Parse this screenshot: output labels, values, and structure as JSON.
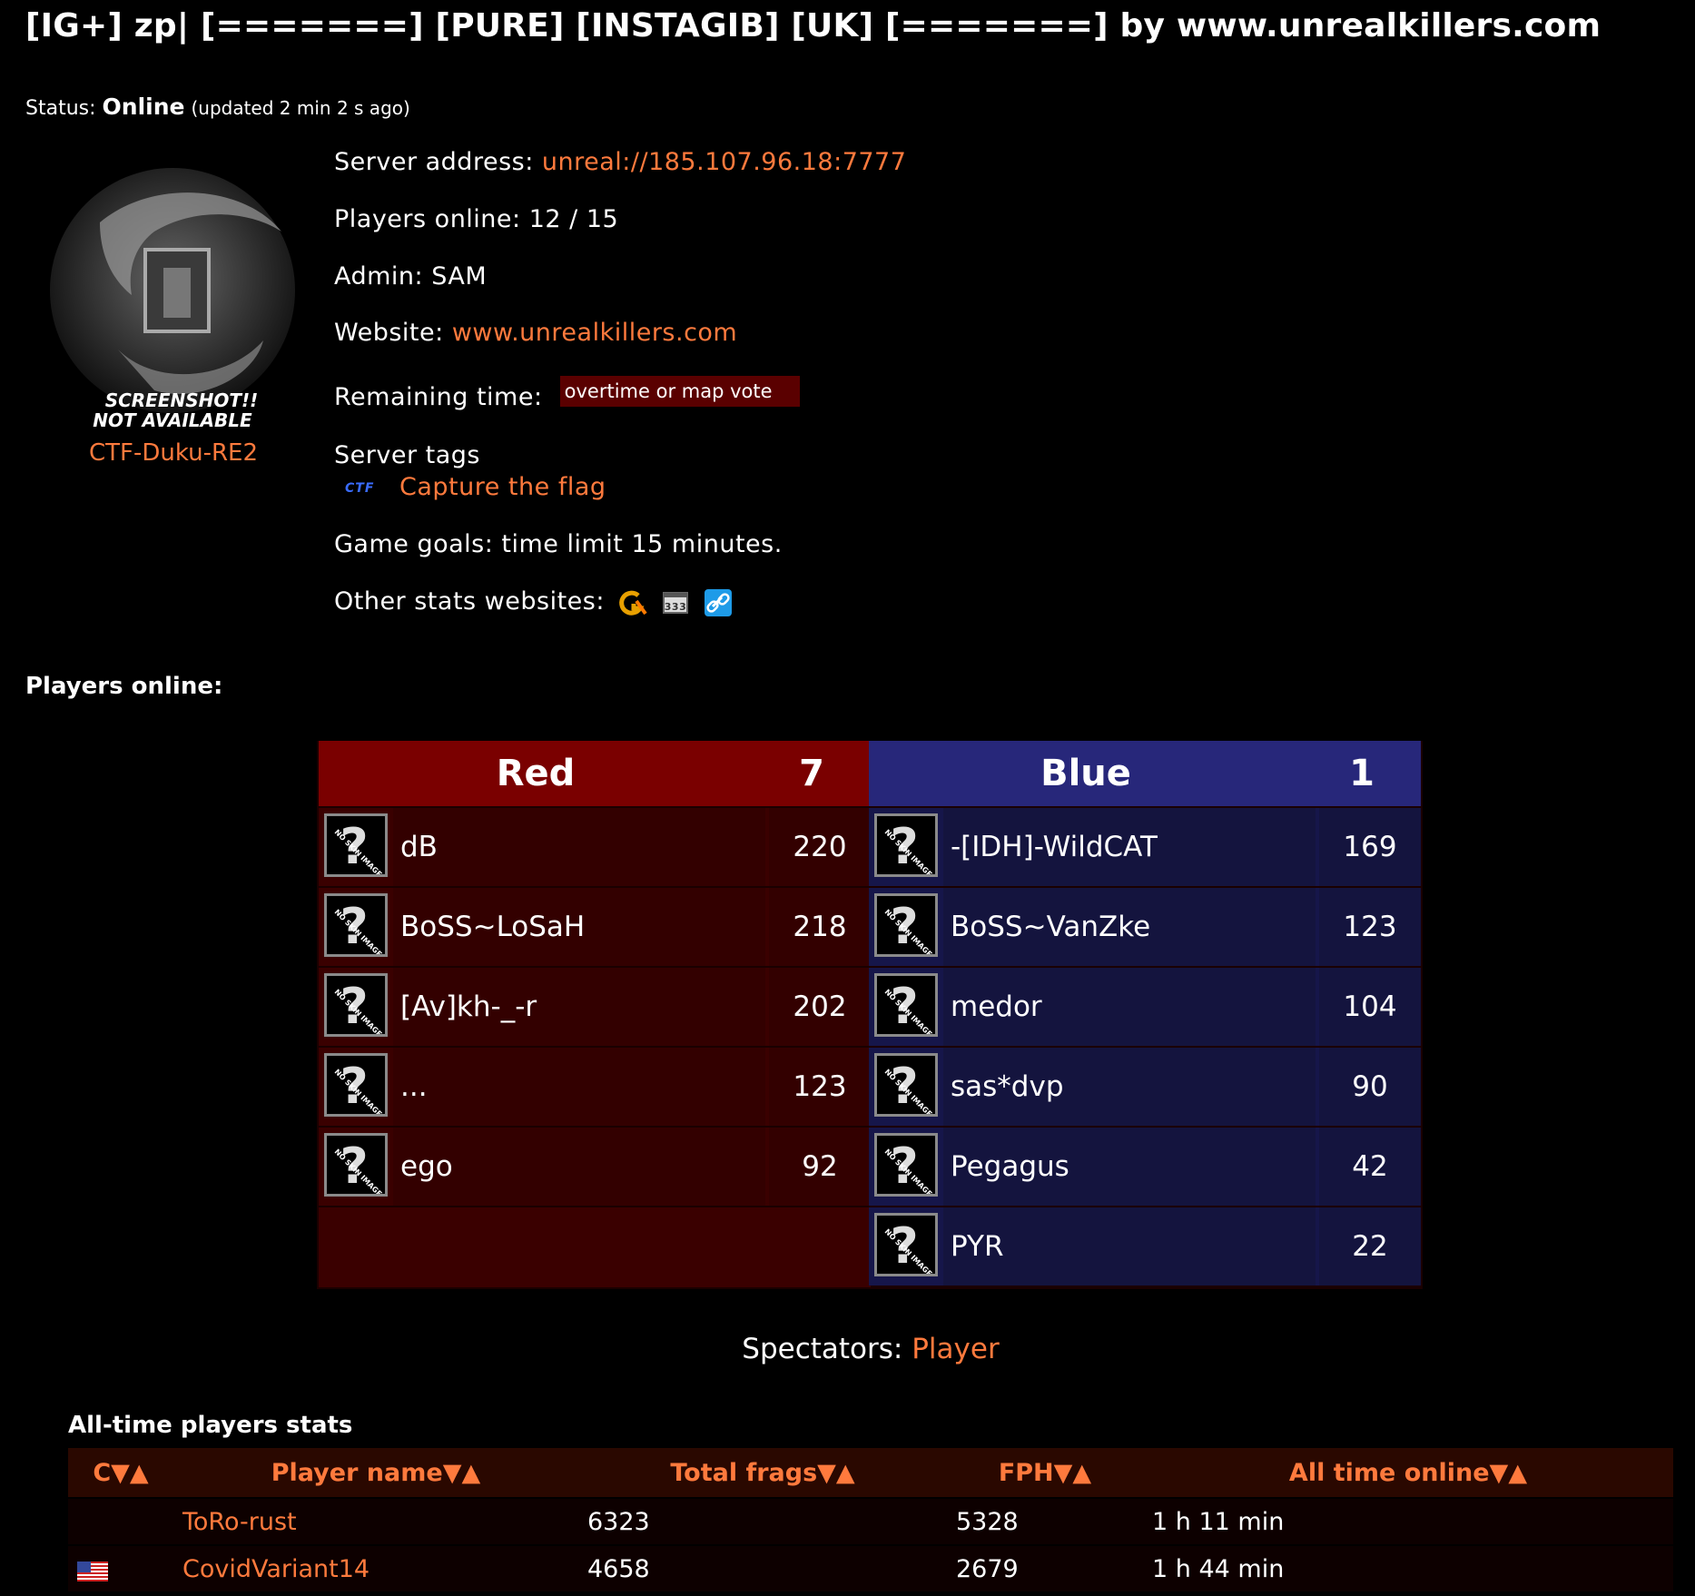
{
  "server": {
    "title": "[IG+] zp| [=======] [PURE] [INSTAGIB] [UK] [=======] by www.unrealkillers.com",
    "status_label": "Status:",
    "status_value": "Online",
    "status_updated": "(updated 2 min 2 s ago)"
  },
  "map": {
    "screenshot_text_1": "SCREENSHOT!!",
    "screenshot_text_2": "NOT AVAILABLE",
    "name": "CTF-Duku-RE2"
  },
  "info": {
    "address_label": "Server address:",
    "address_value": "unreal://185.107.96.18:7777",
    "players_label": "Players online:",
    "players_value": "12 / 15",
    "admin_label": "Admin:",
    "admin_value": "SAM",
    "website_label": "Website:",
    "website_value": "www.unrealkillers.com",
    "remaining_label": "Remaining time:",
    "remaining_value": "overtime or map vote",
    "tags_label": "Server tags",
    "tag_badge": "CTF",
    "tag_name": "Capture the flag",
    "goals": "Game goals: time limit 15 minutes.",
    "other_stats_label": "Other stats websites:"
  },
  "players_heading": "Players online:",
  "teams": {
    "red": {
      "name": "Red",
      "score": "7",
      "players": [
        {
          "name": "dB",
          "score": "220"
        },
        {
          "name": "BoSS~LoSaH",
          "score": "218"
        },
        {
          "name": "[Av]kh-_-r",
          "score": "202"
        },
        {
          "name": "...",
          "score": "123"
        },
        {
          "name": "ego",
          "score": "92"
        }
      ]
    },
    "blue": {
      "name": "Blue",
      "score": "1",
      "players": [
        {
          "name": "-[IDH]-WildCAT",
          "score": "169"
        },
        {
          "name": "BoSS~VanZke",
          "score": "123"
        },
        {
          "name": "medor",
          "score": "104"
        },
        {
          "name": "sas*dvp",
          "score": "90"
        },
        {
          "name": "Pegagus",
          "score": "42"
        },
        {
          "name": "PYR",
          "score": "22"
        }
      ]
    },
    "skin_placeholder_text": "NO SKIN IMAGE"
  },
  "spectators": {
    "label": "Spectators:",
    "value": "Player"
  },
  "alltime": {
    "heading": "All-time players stats",
    "columns": [
      "C▼▲",
      "Player name▼▲",
      "Total frags▼▲",
      "FPH▼▲",
      "All time online▼▲"
    ],
    "rows": [
      {
        "country": "",
        "name": "ToRo-rust",
        "frags": "6323",
        "fph": "5328",
        "online": "1 h 11 min"
      },
      {
        "country": "us-flag",
        "name": "CovidVariant14",
        "frags": "4658",
        "fph": "2679",
        "online": "1 h 44 min"
      }
    ]
  },
  "colors": {
    "accent": "#ff7a3d",
    "red_team": "#7a0000",
    "blue_team": "#27277a"
  }
}
